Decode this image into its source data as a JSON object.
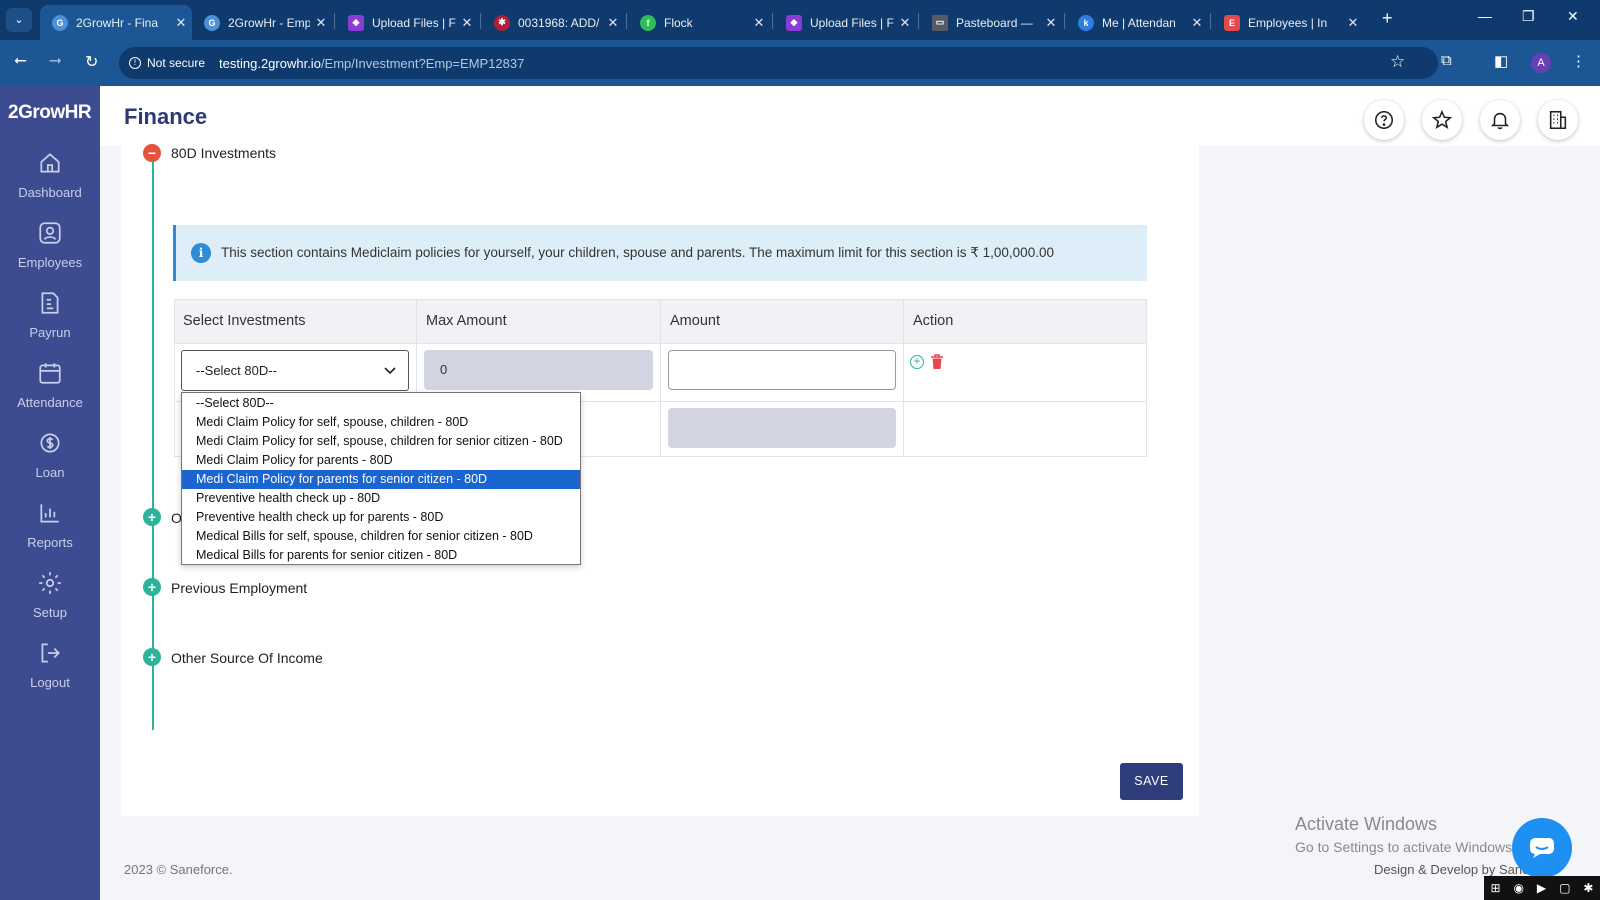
{
  "browser": {
    "tabs": [
      {
        "label": "2GrowHr - Fina",
        "favicon": "2growhr-icon",
        "color": "#4d8fd9",
        "active": true
      },
      {
        "label": "2GrowHr - Emp",
        "favicon": "2growhr-icon",
        "color": "#4d8fd9",
        "active": false
      },
      {
        "label": "Upload Files | F",
        "favicon": "upload-icon",
        "color": "#8a3ad6",
        "active": false
      },
      {
        "label": "0031968: ADD/",
        "favicon": "bug-icon",
        "color": "#b0203a",
        "active": false
      },
      {
        "label": "Flock",
        "favicon": "flock-icon",
        "color": "#2ebd59",
        "active": false
      },
      {
        "label": "Upload Files | F",
        "favicon": "upload-icon",
        "color": "#8a3ad6",
        "active": false
      },
      {
        "label": "Pasteboard —",
        "favicon": "pasteboard-icon",
        "color": "#555b66",
        "active": false
      },
      {
        "label": "Me | Attendan",
        "favicon": "keka-icon",
        "color": "#2f7de0",
        "active": false
      },
      {
        "label": "Employees | In",
        "favicon": "employees-icon",
        "color": "#e5484d",
        "active": false
      }
    ],
    "not_secure_label": "Not secure",
    "url_host": "testing.2growhr.io",
    "url_path": "/Emp/Investment?Emp=EMP12837",
    "profile_initial": "A"
  },
  "app": {
    "logo": "2GrowHR",
    "page_title": "Finance",
    "sidebar": [
      {
        "label": "Dashboard",
        "icon": "home-icon"
      },
      {
        "label": "Employees",
        "icon": "user-icon"
      },
      {
        "label": "Payrun",
        "icon": "payrun-icon"
      },
      {
        "label": "Attendance",
        "icon": "calendar-icon"
      },
      {
        "label": "Loan",
        "icon": "loan-icon"
      },
      {
        "label": "Reports",
        "icon": "reports-icon"
      },
      {
        "label": "Setup",
        "icon": "gear-icon"
      },
      {
        "label": "Logout",
        "icon": "logout-icon"
      }
    ]
  },
  "sections": {
    "s80d": "80D Investments",
    "other_partial": "O",
    "previous_employment": "Previous Employment",
    "other_income": "Other Source Of Income"
  },
  "info_text": "This section contains Mediclaim policies for yourself, your children, spouse and parents. The maximum limit for this section is ₹ 1,00,000.00",
  "table": {
    "headers": [
      "Select Investments",
      "Max Amount",
      "Amount",
      "Action"
    ],
    "row1": {
      "select_value": "--Select 80D--",
      "max_amount": "0",
      "amount": ""
    }
  },
  "dropdown": {
    "options": [
      "--Select 80D--",
      "Medi Claim Policy for self, spouse, children - 80D",
      "Medi Claim Policy for self, spouse, children for senior citizen - 80D",
      "Medi Claim Policy for parents - 80D",
      "Medi Claim Policy for parents for senior citizen - 80D",
      "Preventive health check up - 80D",
      "Preventive health check up for parents - 80D",
      "Medical Bills for self, spouse, children for senior citizen - 80D",
      "Medical Bills for parents for senior citizen - 80D"
    ],
    "highlighted_index": 4
  },
  "save_label": "SAVE",
  "footer": {
    "left": "2023 © Saneforce.",
    "right": "Design & Develop by Saneforce"
  },
  "windows_watermark": {
    "line1": "Activate Windows",
    "line2": "Go to Settings to activate Windows."
  },
  "colors": {
    "sidebar": "#3d4b91",
    "accent_green": "#2cb39a",
    "accent_red": "#e6533c",
    "highlight": "#1a65cf"
  }
}
